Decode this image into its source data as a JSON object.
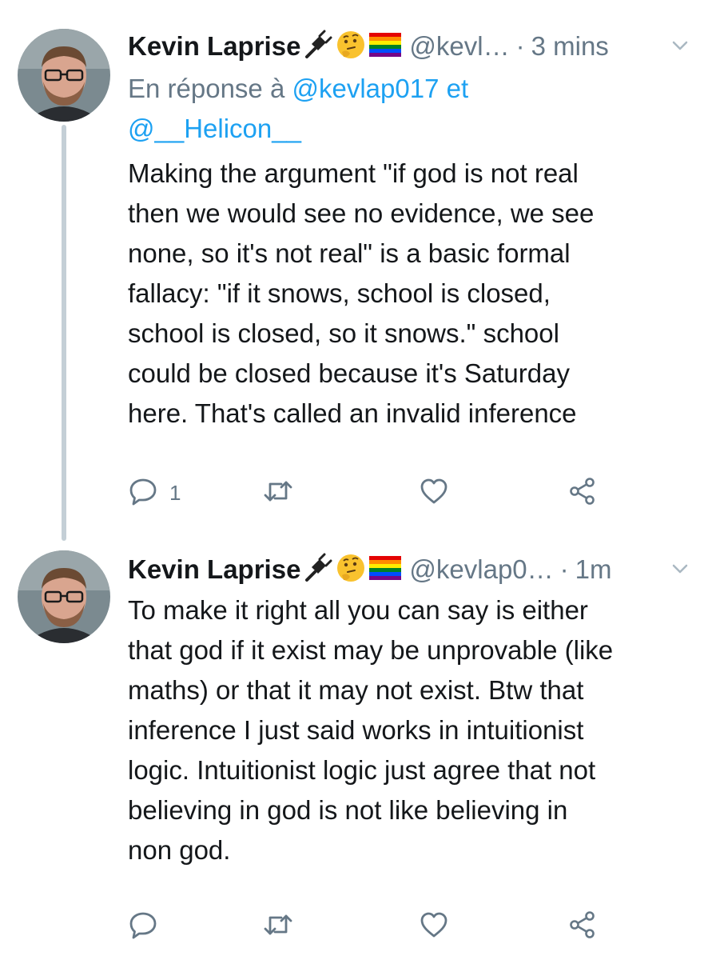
{
  "colors": {
    "text_primary": "#14171a",
    "text_secondary": "#657786",
    "link": "#1da1f2",
    "thread_line": "#c4cfd6"
  },
  "tweets": [
    {
      "display_name": "Kevin Laprise",
      "badges": [
        "plug-emoji",
        "thinking-face-emoji",
        "rainbow-flag-emoji"
      ],
      "handle": "@kevl…",
      "separator": "·",
      "time": "3 mins",
      "reply_prefix": "En réponse à ",
      "reply_mention_1": "@kevlap017",
      "reply_joiner": " et",
      "reply_mention_2": "@__Helicon__",
      "text": "Making the argument \"if god is not real\nthen we would see no evidence, we see\nnone, so it's not real\" is a basic formal\nfallacy: \"if it snows, school is closed,\nschool is closed, so it snows.\" school\ncould be closed because it's Saturday\nhere. That's called an invalid inference",
      "reply_count": "1",
      "icons": [
        "reply-icon",
        "retweet-icon",
        "like-icon",
        "share-icon",
        "chevron-down-icon"
      ]
    },
    {
      "display_name": "Kevin Laprise",
      "badges": [
        "plug-emoji",
        "thinking-face-emoji",
        "rainbow-flag-emoji"
      ],
      "handle": "@kevlap0…",
      "separator": "·",
      "time": "1m",
      "text": "To make it right all you can say is either\nthat god if it exist may be unprovable (like\nmaths) or that it may not exist. Btw that\ninference I just said works in intuitionist\nlogic. Intuitionist logic just agree that not\nbelieving in god is not like believing in\nnon god.",
      "icons": [
        "reply-icon",
        "retweet-icon",
        "like-icon",
        "share-icon",
        "chevron-down-icon"
      ]
    }
  ]
}
